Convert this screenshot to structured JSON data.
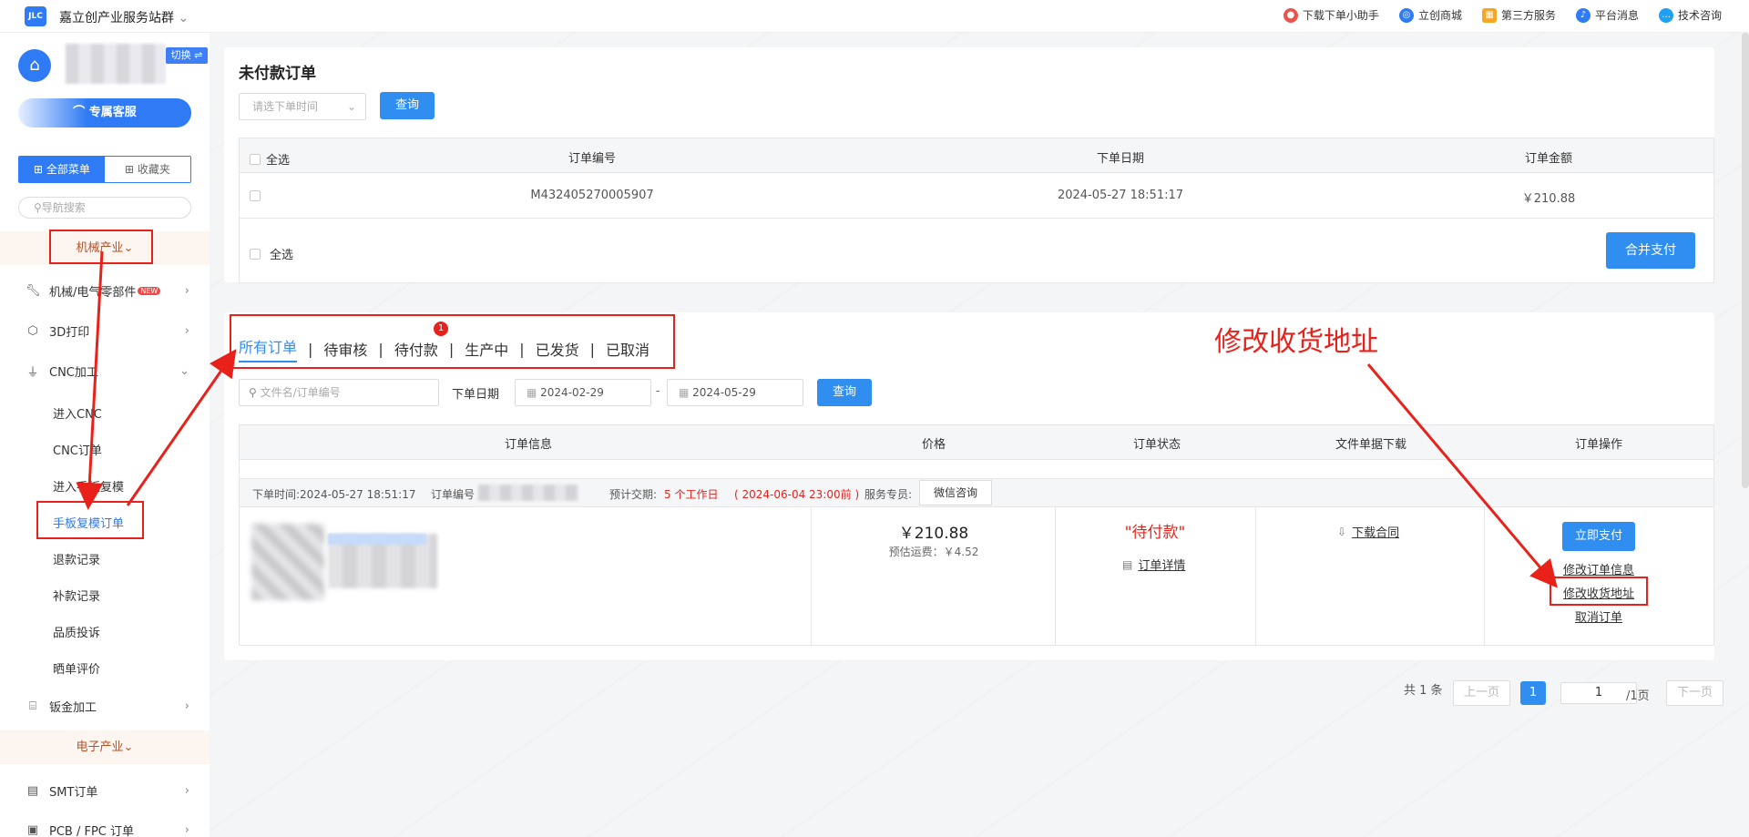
{
  "topbar": {
    "logo": "JLC",
    "title": "嘉立创产业服务站群",
    "links": [
      {
        "label": "下载下单小助手",
        "icon": "assistant-icon",
        "color": "#e8554e"
      },
      {
        "label": "立创商城",
        "icon": "mall-icon",
        "color": "#2f7bf5"
      },
      {
        "label": "第三方服务",
        "icon": "grid-icon",
        "color": "#f5a623"
      },
      {
        "label": "平台消息",
        "icon": "bell-icon",
        "color": "#2f7bf5"
      },
      {
        "label": "技术咨询",
        "icon": "chat-icon",
        "color": "#1fa0f0"
      }
    ]
  },
  "sidebar": {
    "switch_label": "切换 ⇌",
    "vip_label": "专属客服",
    "tabs": [
      "全部菜单",
      "收藏夹"
    ],
    "search_placeholder": "导航搜索",
    "section_mech": "机械产业",
    "section_elec": "电子产业",
    "items": [
      {
        "label": "机械/电气零部件",
        "icon": "wrench-icon",
        "badge": "NEW"
      },
      {
        "label": "3D打印",
        "icon": "cube-icon"
      },
      {
        "label": "CNC加工",
        "icon": "drill-icon"
      }
    ],
    "cnc_sub": [
      "进入CNC",
      "CNC订单",
      "进入手板复模",
      "手板复模订单",
      "退款记录",
      "补款记录",
      "品质投诉",
      "晒单评价"
    ],
    "items2": [
      {
        "label": "钣金加工",
        "icon": "sheet-metal-icon"
      },
      {
        "label": "SMT订单",
        "icon": "smt-icon"
      },
      {
        "label": "PCB / FPC 订单",
        "icon": "pcb-icon"
      }
    ]
  },
  "unpaid": {
    "title": "未付款订单",
    "time_placeholder": "请选下单时间",
    "query_label": "查询",
    "select_all": "全选",
    "columns": [
      "订单编号",
      "下单日期",
      "订单金额"
    ],
    "rows": [
      {
        "order_no": "M432405270005907",
        "date": "2024-05-27 18:51:17",
        "amount": "￥210.88"
      }
    ],
    "merge_pay": "合并支付"
  },
  "orders": {
    "tabs": [
      "所有订单",
      "待审核",
      "待付款",
      "生产中",
      "已发货",
      "已取消"
    ],
    "pending_badge": "1",
    "search_placeholder": "文件名/订单编号",
    "date_label": "下单日期",
    "date_from": "2024-02-29",
    "date_to": "2024-05-29",
    "date_sep": "-",
    "query_label": "查询",
    "columns": [
      "订单信息",
      "价格",
      "订单状态",
      "文件单据下载",
      "订单操作"
    ],
    "info": {
      "time": "下单时间:2024-05-27 18:51:17",
      "order_no_label": "订单编号",
      "delivery_prefix": "预计交期:",
      "delivery_days": "5 个工作日",
      "delivery_date": "( 2024-06-04 23:00前 )",
      "service_label": "服务专员:",
      "wechat": "微信咨询"
    },
    "row": {
      "price": "￥210.88",
      "freight": "预估运费：￥4.52",
      "status": "\"待付款\"",
      "detail": "订单详情",
      "download": "下载合同",
      "pay_now": "立即支付",
      "modify_info": "修改订单信息",
      "modify_addr": "修改收货地址",
      "cancel": "取消订单"
    }
  },
  "annotation": "修改收货地址",
  "pager": {
    "total": "共 1 条",
    "prev": "上一页",
    "current": "1",
    "page_input": "1",
    "page_total": "/1页",
    "next": "下一页"
  }
}
